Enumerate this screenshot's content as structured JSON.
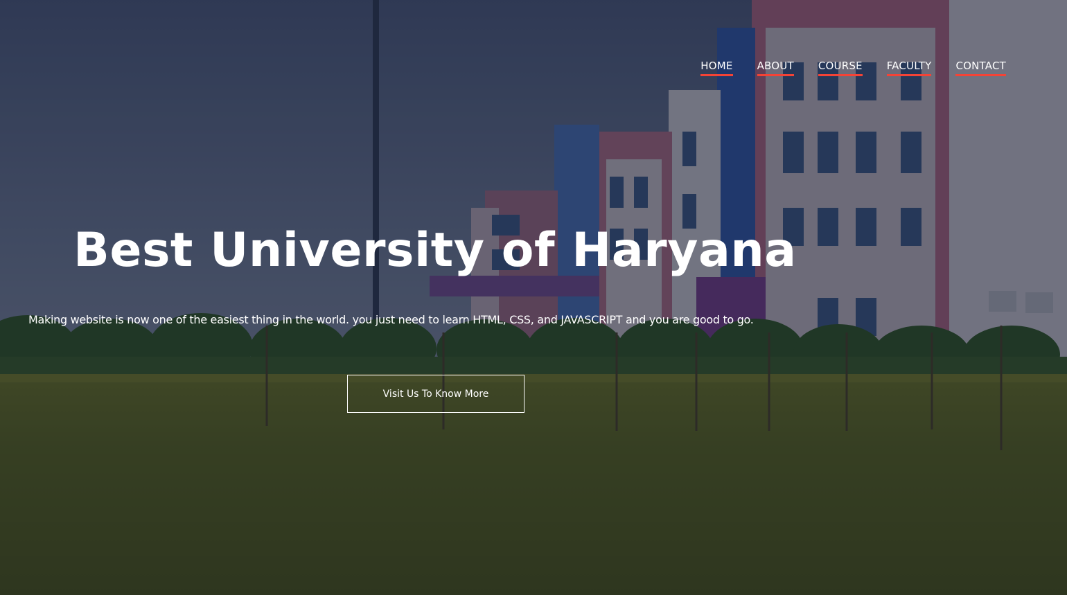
{
  "nav": {
    "items": [
      {
        "label": "HOME"
      },
      {
        "label": "ABOUT"
      },
      {
        "label": "COURSE"
      },
      {
        "label": "FACULTY"
      },
      {
        "label": "CONTACT"
      }
    ]
  },
  "hero": {
    "title": "Best University of Haryana",
    "subtitle": "Making website is now one of the easiest thing in the world. you just need to learn HTML, CSS, and JAVASCRIPT and you are good to go.",
    "cta_label": "Visit Us To Know More"
  },
  "colors": {
    "nav_underline": "#f44336",
    "text": "#ffffff",
    "overlay": "rgba(4, 9, 30, 0.52)"
  }
}
